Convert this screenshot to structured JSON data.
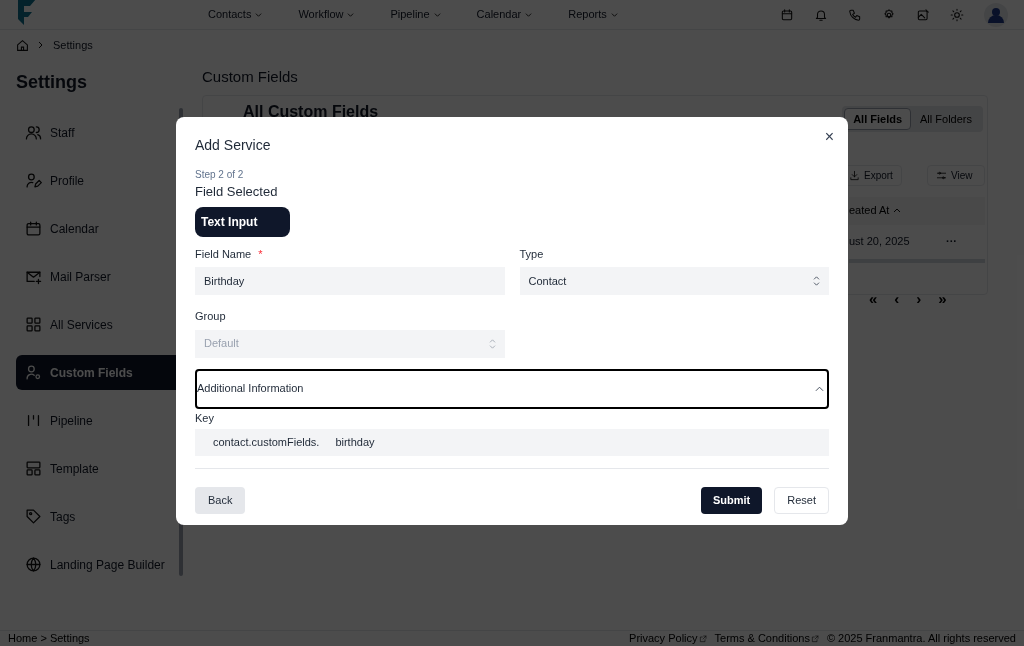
{
  "nav": {
    "menus": [
      "Contacts",
      "Workflow",
      "Pipeline",
      "Calendar",
      "Reports"
    ]
  },
  "breadcrumb": {
    "current": "Settings"
  },
  "sidebar": {
    "title": "Settings",
    "items": [
      {
        "label": "Staff",
        "kind": "staff",
        "selected": false
      },
      {
        "label": "Profile",
        "kind": "profile",
        "selected": false
      },
      {
        "label": "Calendar",
        "kind": "calendar",
        "selected": false
      },
      {
        "label": "Mail Parser",
        "kind": "mail",
        "selected": false
      },
      {
        "label": "All Services",
        "kind": "grid",
        "selected": false
      },
      {
        "label": "Custom Fields",
        "kind": "fields",
        "selected": true
      },
      {
        "label": "Pipeline",
        "kind": "pipeline",
        "selected": false
      },
      {
        "label": "Template",
        "kind": "template",
        "selected": false
      },
      {
        "label": "Tags",
        "kind": "tag",
        "selected": false
      },
      {
        "label": "Landing Page Builder",
        "kind": "globe",
        "selected": false
      }
    ]
  },
  "main": {
    "title": "Custom Fields",
    "card_title": "All Custom Fields",
    "view_tabs": [
      {
        "label": "All Fields",
        "selected": true
      },
      {
        "label": "All Folders",
        "selected": false
      }
    ],
    "export_button": "Export",
    "view_button": "View",
    "table": {
      "column_header": "eated At",
      "cell": "ust 20, 2025",
      "row_menu": "···"
    },
    "pagination": [
      "«",
      "‹",
      "›",
      "»"
    ]
  },
  "modal": {
    "title": "Add Service",
    "step": "Step 2 of 2",
    "subtitle": "Field Selected",
    "field_type": "Text Input",
    "fields": [
      {
        "label": "Field Name",
        "required_mark": "*",
        "kind": "text",
        "value": "Birthday",
        "disabled": false
      },
      {
        "label": "Type",
        "kind": "select",
        "value": "Contact",
        "disabled": false
      },
      {
        "label": "Group",
        "kind": "select",
        "value": "Default",
        "disabled": true
      }
    ],
    "section": {
      "label": "Additional Information",
      "expanded": true
    },
    "key": {
      "label": "Key",
      "prefix": "contact.customFields.",
      "value": "birthday"
    },
    "back_button": "Back",
    "submit_button": "Submit",
    "reset_button": "Reset",
    "close": "×"
  },
  "footer": {
    "breadcrumb": "Home > Settings",
    "links": [
      "Privacy Policy",
      "Terms & Conditions"
    ],
    "copyright": "© 2025 Franmantra. All rights reserved"
  }
}
